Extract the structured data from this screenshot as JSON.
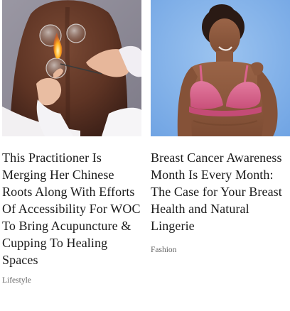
{
  "articles": [
    {
      "title": "This Practitioner Is Merging Her Chinese Roots Along With Efforts Of Accessibility For WOC To Bring Acupuncture & Cupping To Healing Spaces",
      "category": "Lifestyle",
      "image_icon": "cupping-therapy-photo"
    },
    {
      "title": "Breast Cancer Awareness Month Is Every Month: The Case for Your Breast Health and Natural Lingerie",
      "category": "Fashion",
      "image_icon": "lingerie-model-photo"
    }
  ],
  "colors": {
    "headline": "#1a1a1a",
    "category": "#666666",
    "bra_pink": "#d9638c",
    "backdrop_blue": "#7fb0e8"
  }
}
